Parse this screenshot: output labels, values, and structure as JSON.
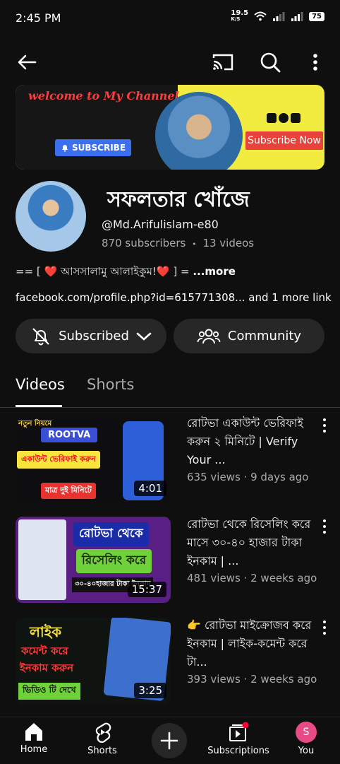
{
  "status": {
    "time": "2:45 PM",
    "net_speed": "19.5",
    "net_unit": "K/S",
    "battery": "75"
  },
  "banner": {
    "title": "welcome to My Channel",
    "subscribe_btn": "SUBSCRIBE",
    "subscribe_now": "Subscribe Now"
  },
  "channel": {
    "name": "সফলতার খোঁজে",
    "handle": "@Md.Arifulislam-e80",
    "subscribers": "870 subscribers",
    "separator": "•",
    "videos": "13 videos",
    "description_prefix": "== [ ❤️ আসসালামু আলাইকুম!❤️ ] = ",
    "description_more": "...more",
    "link": "facebook.com/profile.php?id=615771308...",
    "link_more": " and 1 more link"
  },
  "actions": {
    "subscribed_label": "Subscribed",
    "community_label": "Community"
  },
  "tabs": [
    {
      "label": "Videos",
      "active": true
    },
    {
      "label": "Shorts",
      "active": false
    }
  ],
  "videos": [
    {
      "title": "রোটভা একাউন্ট ভেরিফাই করুন ২ মিনিটে | Verify Your ...",
      "views": "635 views",
      "sep": "·",
      "age": "9 days ago",
      "duration": "4:01",
      "thumb_text_1": "নতুন নিয়মে",
      "thumb_text_2": "ROOTVA",
      "thumb_text_3": "একাউন্ট ভেরিফাই করুন",
      "thumb_text_4": "মাত্র দুই মিনিটে"
    },
    {
      "title": "রোটভা থেকে রিসেলিং করে মাসে ৩০-৪০ হাজার টাকা ইনকাম | ...",
      "views": "481 views",
      "sep": "·",
      "age": "2 weeks ago",
      "duration": "15:37",
      "thumb_text_1": "রোটভা থেকে",
      "thumb_text_2": "রিসেলিং করে",
      "thumb_text_3": "৩০-৪০হাজার টাকা ইনকাম"
    },
    {
      "title": "👉 রোটভা মাইক্রোজব করে ইনকাম | লাইক-কমেন্ট করে টা...",
      "views": "393 views",
      "sep": "·",
      "age": "2 weeks ago",
      "duration": "3:25",
      "thumb_text_1": "লাইক",
      "thumb_text_2": "কমেন্ট করে",
      "thumb_text_3": "ইনকাম করুন",
      "thumb_text_4": "ভিডিও টি দেখে"
    }
  ],
  "bottom_nav": {
    "home": "Home",
    "shorts": "Shorts",
    "subscriptions": "Subscriptions",
    "you": "You",
    "you_initial": "S"
  },
  "colors": {
    "background": "#0f0f0f",
    "pill": "#272727",
    "secondary_text": "#aaaaaa",
    "accent_red": "#ff0033"
  },
  "icons": [
    "back-arrow-icon",
    "cast-icon",
    "search-icon",
    "more-vert-icon",
    "bell-off-icon",
    "chevron-down-icon",
    "community-icon",
    "home-icon",
    "shorts-icon",
    "plus-icon",
    "subscriptions-icon"
  ]
}
